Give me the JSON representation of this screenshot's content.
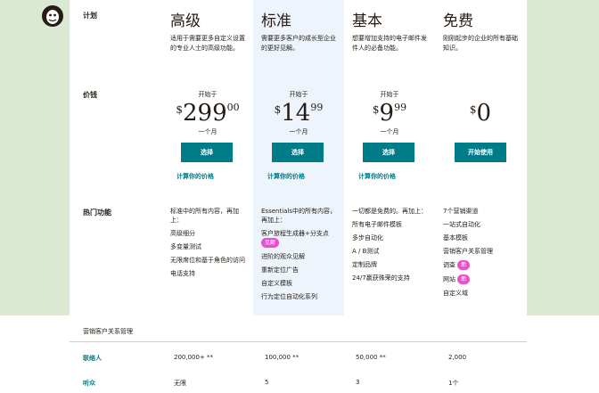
{
  "row_labels": {
    "plan": "计划",
    "price": "价钱",
    "features": "热门功能"
  },
  "plans": [
    {
      "name": "高级",
      "desc": "适用于需要更多自定义设置的专业人士的高级功能。",
      "starts": "开始于",
      "currency": "$",
      "amount": "299",
      "cents": "00",
      "per": "一个月",
      "button": "选择",
      "calc": "计算你的价格",
      "features_intro": "标准中的所有内容，再加上：",
      "features": [
        "高级细分",
        "多变量测试",
        "无限席位和基于角色的访问",
        "电话支持"
      ]
    },
    {
      "name": "标准",
      "desc": "需要更多客户的成长型企业的更好见解。",
      "starts": "开始于",
      "currency": "$",
      "amount": "14",
      "cents": "99",
      "per": "一个月",
      "button": "选择",
      "calc": "计算你的价格",
      "features_intro": "Essentials中的所有内容，再加上：",
      "features": [
        "客户旅程生成器+分支点",
        "进阶的观众见解",
        "重新定位广告",
        "自定义模板",
        "行为定位自动化系列"
      ],
      "badge": "见解"
    },
    {
      "name": "基本",
      "desc": "想要增加支持的电子邮件发件人的必备功能。",
      "starts": "开始于",
      "currency": "$",
      "amount": "9",
      "cents": "99",
      "per": "一个月",
      "button": "选择",
      "calc": "计算你的价格",
      "features_intro": "一切都是免费的。再加上：",
      "features": [
        "所有电子邮件模板",
        "多步自动化",
        "A / B测试",
        "定制品牌",
        "24/7赢获殊荣的支持"
      ]
    },
    {
      "name": "免费",
      "desc": "刚刚起步的企业的所有基础知识。",
      "currency": "$",
      "amount": "0",
      "button": "开始使用",
      "features": [
        "7个营销渠道",
        "一站式自动化",
        "基本模板",
        "营销客户关系管理",
        "调查",
        "网站",
        "自定义域"
      ],
      "badge": "新"
    }
  ],
  "crm": {
    "title": "营销客户关系管理",
    "rows": [
      {
        "label": "联络人",
        "values": [
          "200,000+ **",
          "100,000 **",
          "50,000 **",
          "2,000"
        ]
      },
      {
        "label": "听众",
        "values": [
          "无限",
          "5",
          "3",
          "1个"
        ]
      }
    ]
  },
  "colors": {
    "teal": "#007c89",
    "badge": "#e84ecf",
    "bg_green": "#dbe9d3",
    "standard_highlight": "#eef4fc"
  }
}
